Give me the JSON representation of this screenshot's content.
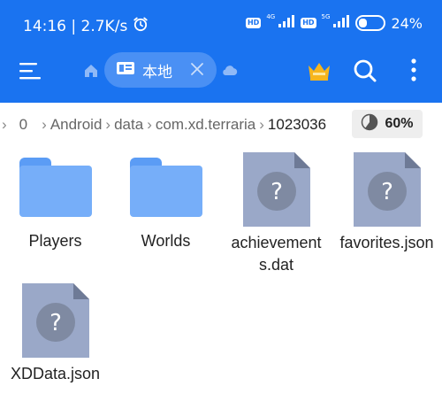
{
  "status": {
    "time_speed": "14:16 | 2.7K/s",
    "net_gen_1": "4G",
    "net_gen_2": "5G",
    "hd_label": "HD",
    "battery": "24%",
    "battery_level": 0.24
  },
  "toolbar": {
    "menu_icon": "hamburger-menu-icon",
    "home_icon": "home-icon",
    "location_label": "本地",
    "cloud_icon": "cloud-icon",
    "crown_icon": "crown-icon",
    "search_icon": "search-icon",
    "more_icon": "more-vertical-icon"
  },
  "breadcrumb": {
    "items": [
      "0",
      "Android",
      "data",
      "com.xd.terraria",
      "1023036"
    ],
    "storage_percent": "60%",
    "storage_fraction": 0.6
  },
  "files": [
    {
      "name": "Players",
      "type": "folder"
    },
    {
      "name": "Worlds",
      "type": "folder"
    },
    {
      "name": "achievements.dat",
      "type": "unknown"
    },
    {
      "name": "favorites.json",
      "type": "unknown"
    },
    {
      "name": "XDData.json",
      "type": "unknown"
    }
  ],
  "colors": {
    "header_bg": "#1a73f0",
    "folder": "#76aef9",
    "unknown_file": "#9aa8c8",
    "unknown_badge": "#7f8aa2"
  }
}
